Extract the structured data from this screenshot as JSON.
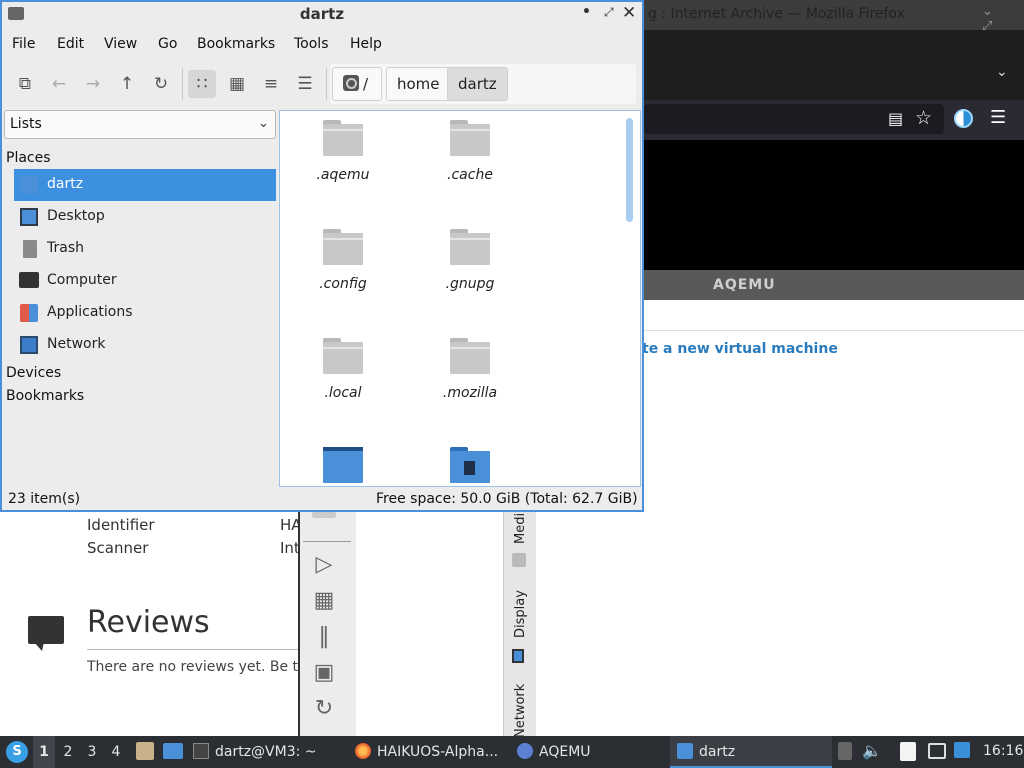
{
  "firefox": {
    "title": "g : Internet Archive — Mozilla Firefox",
    "window_controls": "⌄ ⤢ ✕",
    "aqemu_bar_label": "AQEMU",
    "create_vm_link": "te a new virtual machine",
    "metadata": [
      {
        "label": "Identifier",
        "value": "HA"
      },
      {
        "label": "Scanner",
        "value": "Int"
      }
    ],
    "reviews_title": "Reviews",
    "reviews_empty": "There are no reviews yet. Be the fi"
  },
  "aqemu": {
    "vertical_tabs": [
      "Medi",
      "Display",
      "Network"
    ]
  },
  "file_manager": {
    "title": "dartz",
    "menu": [
      "File",
      "Edit",
      "View",
      "Go",
      "Bookmarks",
      "Tools",
      "Help"
    ],
    "breadcrumbs": [
      "/",
      "home",
      "dartz"
    ],
    "side_pane_mode": "Lists",
    "places_header": "Places",
    "places": [
      {
        "label": "dartz",
        "icon": "home-folder-icon",
        "selected": true
      },
      {
        "label": "Desktop",
        "icon": "desktop-icon",
        "selected": false
      },
      {
        "label": "Trash",
        "icon": "trash-icon",
        "selected": false
      },
      {
        "label": "Computer",
        "icon": "computer-icon",
        "selected": false
      },
      {
        "label": "Applications",
        "icon": "applications-icon",
        "selected": false
      },
      {
        "label": "Network",
        "icon": "network-icon",
        "selected": false
      }
    ],
    "devices_header": "Devices",
    "bookmarks_header": "Bookmarks",
    "files": [
      {
        "name": ".aqemu",
        "icon": "folder-icon"
      },
      {
        "name": ".cache",
        "icon": "folder-icon"
      },
      {
        "name": ".config",
        "icon": "folder-icon"
      },
      {
        "name": ".gnupg",
        "icon": "folder-icon"
      },
      {
        "name": ".local",
        "icon": "folder-icon"
      },
      {
        "name": ".mozilla",
        "icon": "folder-icon"
      },
      {
        "name": "",
        "icon": "desktop-folder-icon"
      },
      {
        "name": "",
        "icon": "documents-folder-icon"
      }
    ],
    "status_items": "23 item(s)",
    "status_space": "Free space: 50.0 GiB (Total: 62.7 GiB)"
  },
  "taskbar": {
    "start_label": "S",
    "workspaces": [
      "1",
      "2",
      "3",
      "4"
    ],
    "active_workspace": "1",
    "tasks": [
      {
        "label": "dartz@VM3: ~",
        "icon": "terminal-icon"
      },
      {
        "label": "HAIKUOS-Alpha...",
        "icon": "firefox-icon"
      },
      {
        "label": "AQEMU",
        "icon": "aqemu-icon"
      },
      {
        "label": "dartz",
        "icon": "folder-icon",
        "active": true
      }
    ],
    "clock": "16:16"
  },
  "colors": {
    "selection": "#3d8fe0",
    "window_border": "#4a90d9",
    "taskbar": "#2b2e33",
    "link": "#2a7bbd"
  }
}
